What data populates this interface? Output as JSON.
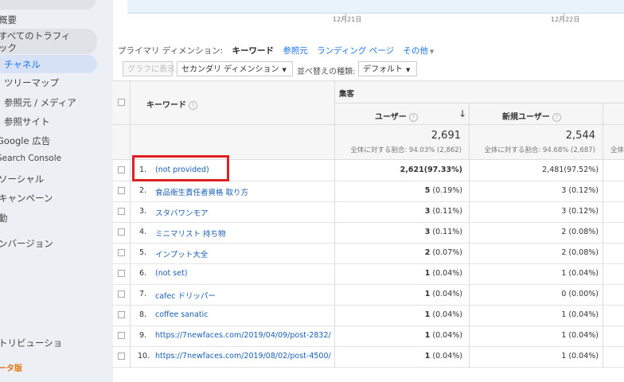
{
  "sidebar": {
    "items": [
      {
        "label": "概要"
      },
      {
        "label": "すべてのトラフィ"
      },
      {
        "label": "ック"
      },
      {
        "label": "チャネル"
      },
      {
        "label": "ツリーマップ"
      },
      {
        "label": "参照元 / メディア"
      },
      {
        "label": "参照サイト"
      },
      {
        "label": "Google 広告"
      },
      {
        "label": "Search Console"
      },
      {
        "label": "ソーシャル"
      },
      {
        "label": "キャンペーン"
      },
      {
        "label": "動"
      },
      {
        "label": "ンバージョン"
      },
      {
        "label": "トリビューショ"
      },
      {
        "label": "ータ版"
      }
    ]
  },
  "chart": {
    "dates": [
      "12月21日",
      "12月22日"
    ]
  },
  "dimensions": {
    "label": "プライマリ ディメンション:",
    "active": "キーワード",
    "links": [
      "参照元",
      "ランディング ページ",
      "その他"
    ]
  },
  "controls": {
    "graph_button": "グラフに表示",
    "secondary_dimension": "セカンダリ ディメンション",
    "sort_label": "並べ替えの種類:",
    "sort_value": "デフォルト"
  },
  "table": {
    "group_header": "集客",
    "col_keyword": "キーワード",
    "col_users": "ユーザー",
    "col_new_users": "新規ユーザー",
    "sort_arrow": "↓",
    "totals": {
      "users": "2,691",
      "users_sub": "全体に対する割合: 94.03% (2,862)",
      "new_users": "2,544",
      "new_users_sub": "全体に対する割合: 94.68% (2,687)",
      "cut_sub": "全体"
    },
    "rows": [
      {
        "n": "1.",
        "keyword": "(not provided)",
        "users": "2,621",
        "users_pct": "(97.33%)",
        "new": "2,481",
        "new_pct": "(97.52%)"
      },
      {
        "n": "2.",
        "keyword": "食品衛生責任者資格 取り方",
        "users": "5",
        "users_pct": "(0.19%)",
        "new": "3",
        "new_pct": "(0.12%)"
      },
      {
        "n": "3.",
        "keyword": "スタバワンモア",
        "users": "3",
        "users_pct": "(0.11%)",
        "new": "3",
        "new_pct": "(0.12%)"
      },
      {
        "n": "4.",
        "keyword": "ミニマリスト 持ち物",
        "users": "3",
        "users_pct": "(0.11%)",
        "new": "2",
        "new_pct": "(0.08%)"
      },
      {
        "n": "5.",
        "keyword": "インプット大全",
        "users": "2",
        "users_pct": "(0.07%)",
        "new": "2",
        "new_pct": "(0.08%)"
      },
      {
        "n": "6.",
        "keyword": "(not set)",
        "users": "1",
        "users_pct": "(0.04%)",
        "new": "1",
        "new_pct": "(0.04%)"
      },
      {
        "n": "7.",
        "keyword": "cafec ドリッパー",
        "users": "1",
        "users_pct": "(0.04%)",
        "new": "0",
        "new_pct": "(0.00%)"
      },
      {
        "n": "8.",
        "keyword": "coffee sanatic",
        "users": "1",
        "users_pct": "(0.04%)",
        "new": "1",
        "new_pct": "(0.04%)"
      },
      {
        "n": "9.",
        "keyword": "https://7newfaces.com/2019/04/09/post-2832/",
        "users": "1",
        "users_pct": "(0.04%)",
        "new": "1",
        "new_pct": "(0.04%)"
      },
      {
        "n": "10.",
        "keyword": "https://7newfaces.com/2019/08/02/post-4500/",
        "users": "1",
        "users_pct": "(0.04%)",
        "new": "1",
        "new_pct": "(0.04%)"
      }
    ]
  },
  "colors": {
    "link": "#1a5fb4",
    "highlight": "#e02020",
    "accent": "#1a73e8"
  }
}
